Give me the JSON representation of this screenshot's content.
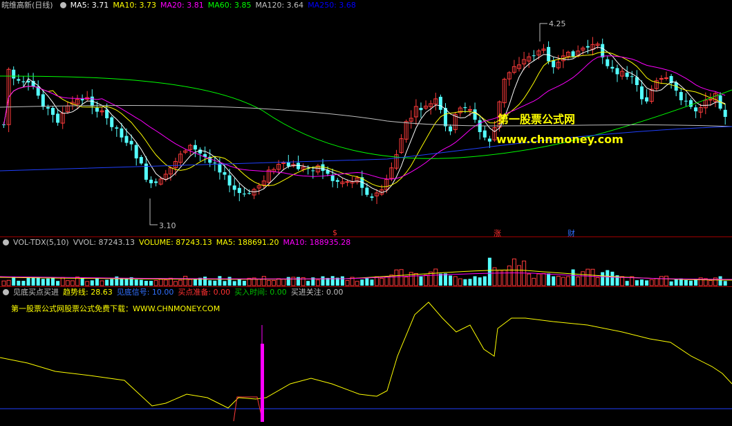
{
  "main": {
    "title": "皖维高新(日线)",
    "ma": [
      {
        "label": "MA5: 3.71",
        "color": "#ffffff"
      },
      {
        "label": "MA10: 3.73",
        "color": "#ffff00"
      },
      {
        "label": "MA20: 3.81",
        "color": "#ff00ff"
      },
      {
        "label": "MA60: 3.85",
        "color": "#00ff00"
      },
      {
        "label": "MA120: 3.64",
        "color": "#c0c0c0"
      },
      {
        "label": "MA250: 3.68",
        "color": "#0000ff"
      }
    ],
    "high_label": "4.25",
    "low_label": "3.10",
    "watermark_cn": "第一股票公式网",
    "watermark_url": "www.chnmoney.com",
    "event_marks": [
      {
        "text": "$",
        "color": "#ff3030"
      },
      {
        "text": "涨",
        "color": "#ff3030"
      },
      {
        "text": "财",
        "color": "#3070ff"
      }
    ]
  },
  "volume": {
    "labels": [
      {
        "label": "VOL-TDX(5,10)",
        "color": "#c0c0c0"
      },
      {
        "label": "VVOL: 87243.13",
        "color": "#c0c0c0"
      },
      {
        "label": "VOLUME: 87243.13",
        "color": "#ffff00"
      },
      {
        "label": "MA5: 188691.20",
        "color": "#ffff00"
      },
      {
        "label": "MA10: 188935.28",
        "color": "#ff00ff"
      }
    ]
  },
  "indicator": {
    "labels": [
      {
        "label": "见底买点买进",
        "color": "#c0c0c0"
      },
      {
        "label": "趋势线: 28.63",
        "color": "#ffff00"
      },
      {
        "label": "见底信号: 10.00",
        "color": "#3070ff"
      },
      {
        "label": "买点准备: 0.00",
        "color": "#ff3030"
      },
      {
        "label": "买入时间: 0.00",
        "color": "#00c000"
      },
      {
        "label": "买进关注: 0.00",
        "color": "#c0c0c0"
      }
    ],
    "note": "第一股票公式网股票公式免费下载：WWW.CHNMONEY.COM"
  },
  "colors": {
    "up": "#ff3b3b",
    "down": "#54ffff",
    "bg": "#000000",
    "divider": "#a00000"
  }
}
